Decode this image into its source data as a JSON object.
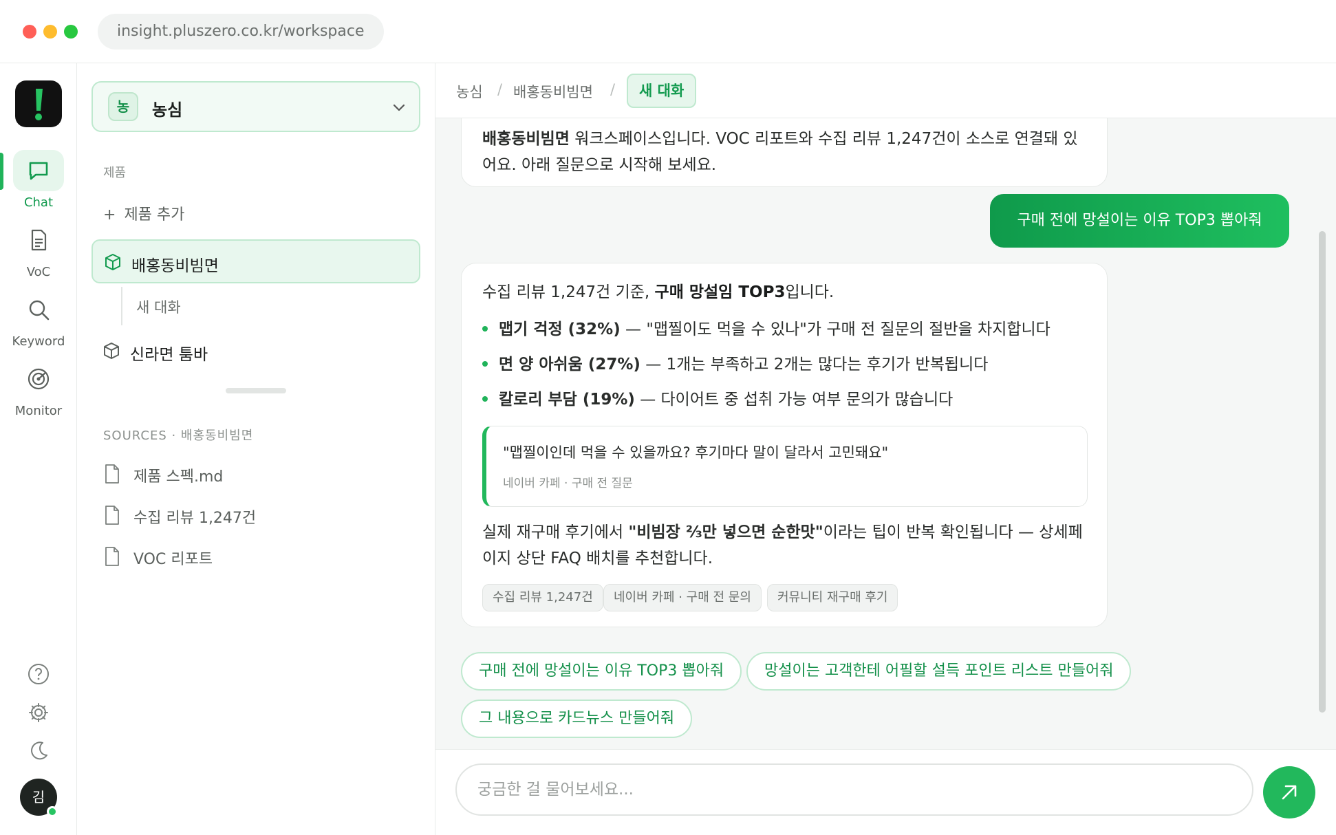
{
  "browser": {
    "url": "insight.pluszero.co.kr/workspace"
  },
  "rail": {
    "items": [
      {
        "label": "Chat",
        "icon": "chat-icon",
        "active": true
      },
      {
        "label": "VoC",
        "icon": "document-icon",
        "active": false
      },
      {
        "label": "Keyword",
        "icon": "search-icon",
        "active": false
      },
      {
        "label": "Monitor",
        "icon": "radar-icon",
        "active": false
      }
    ],
    "avatar_initial": "김"
  },
  "sidebar": {
    "brand": {
      "badge": "농",
      "name": "농심"
    },
    "products_label": "제품",
    "add_product": "제품 추가",
    "products": [
      {
        "name": "배홍동비빔면",
        "active": true,
        "sub": [
          "새 대화"
        ]
      },
      {
        "name": "신라면 툼바",
        "active": false
      }
    ],
    "sources_label": "SOURCES · 배홍동비빔면",
    "sources": [
      "제품 스펙.md",
      "수집 리뷰 1,247건",
      "VOC 리포트"
    ]
  },
  "breadcrumb": {
    "items": [
      "농심",
      "배홍동비빔면"
    ],
    "active": "새 대화"
  },
  "chat": {
    "previous": {
      "bold": "배홍동비빔면",
      "text": " 워크스페이스입니다. VOC 리포트와 수집 리뷰 1,247건이 소스로 연결돼 있어요. 아래 질문으로 시작해 보세요."
    },
    "user_message": "구매 전에 망설이는 이유 TOP3 뽑아줘",
    "answer": {
      "intro_pre": "수집 리뷰 1,247건 기준, ",
      "intro_bold": "구매 망설임 TOP3",
      "intro_post": "입니다.",
      "bullets": [
        {
          "bold": "맵기 걱정 (32%)",
          "text": " — \"맵찔이도 먹을 수 있나\"가 구매 전 질문의 절반을 차지합니다"
        },
        {
          "bold": "면 양 아쉬움 (27%)",
          "text": " — 1개는 부족하고 2개는 많다는 후기가 반복됩니다"
        },
        {
          "bold": "칼로리 부담 (19%)",
          "text": " — 다이어트 중 섭취 가능 여부 문의가 많습니다"
        }
      ],
      "quote": {
        "text": "\"맵찔이인데 먹을 수 있을까요? 후기마다 말이 달라서 고민돼요\"",
        "source": "네이버 카페 · 구매 전 질문"
      },
      "closing_pre": "실제 재구매 후기에서 ",
      "closing_bold": "\"비빔장 ⅔만 넣으면 순한맛\"",
      "closing_post": "이라는 팁이 반복 확인됩니다 — 상세페이지 상단 FAQ 배치를 추천합니다.",
      "source_chips": [
        "수집 리뷰 1,247건",
        "네이버 카페 · 구매 전 문의",
        "커뮤니티 재구매 후기"
      ]
    },
    "suggestions": [
      "구매 전에 망설이는 이유 TOP3 뽑아줘",
      "망설이는 고객한테 어필할 설득 포인트 리스트 만들어줘",
      "그 내용으로 카드뉴스 만들어줘"
    ]
  },
  "composer": {
    "placeholder": "궁금한 걸 물어보세요..."
  },
  "colors": {
    "accent": "#20b35a",
    "accent_dark": "#0f9a4b",
    "accent_bg": "#e6f6ec"
  }
}
